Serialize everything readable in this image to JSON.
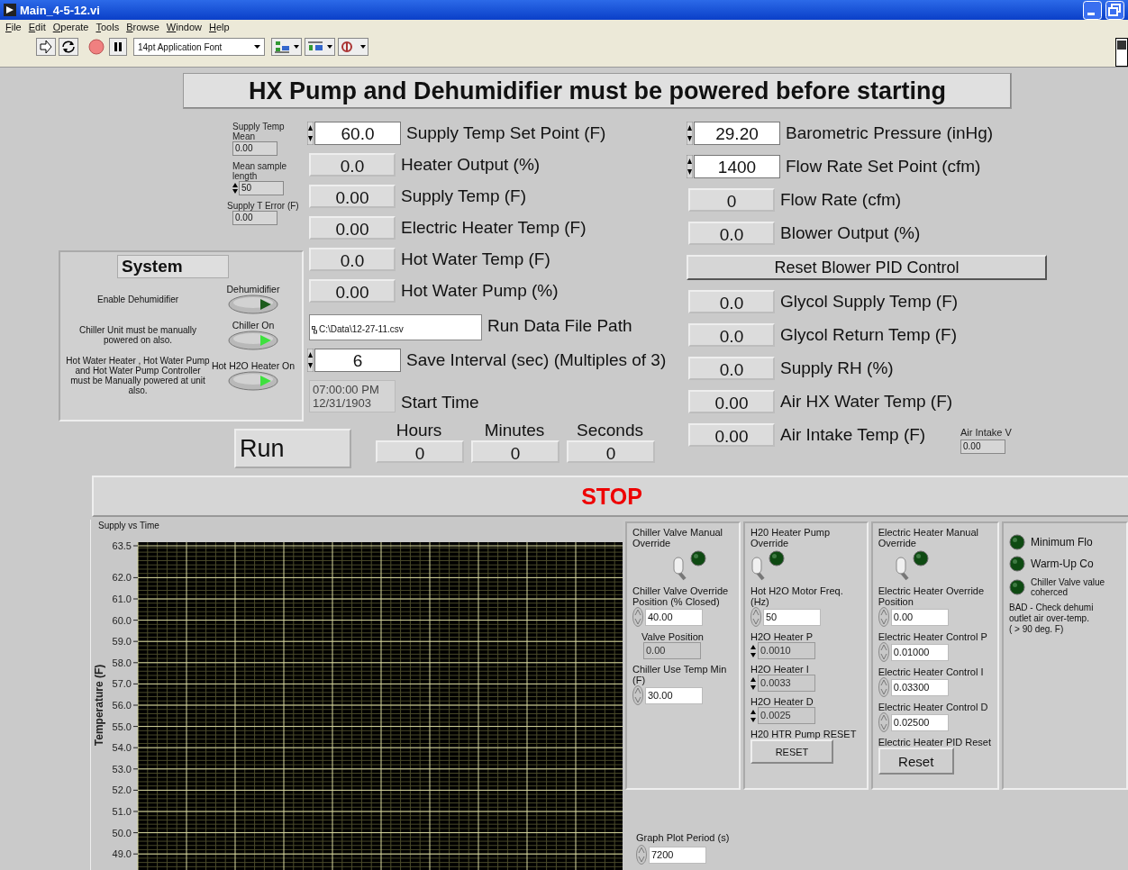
{
  "window": {
    "title": "Main_4-5-12.vi"
  },
  "menu": [
    "File",
    "Edit",
    "Operate",
    "Tools",
    "Browse",
    "Window",
    "Help"
  ],
  "toolbar": {
    "font": "14pt Application Font"
  },
  "banner": "HX Pump and Dehumidifier must be powered before starting",
  "small_indicators": [
    {
      "label": "Supply Temp Mean",
      "value": "0.00",
      "kind": "indicator"
    },
    {
      "label": "Mean sample length",
      "value": "50",
      "kind": "control"
    },
    {
      "label": "Supply T Error (F)",
      "value": "0.00",
      "kind": "indicator"
    }
  ],
  "left_fields": [
    {
      "kind": "control",
      "value": "60.0",
      "label": "Supply Temp Set Point (F)"
    },
    {
      "kind": "indicator",
      "value": "0.0",
      "label": "Heater Output (%)"
    },
    {
      "kind": "indicator",
      "value": "0.00",
      "label": "Supply Temp (F)"
    },
    {
      "kind": "indicator",
      "value": "0.00",
      "label": "Electric Heater Temp (F)"
    },
    {
      "kind": "indicator",
      "value": "0.0",
      "label": "Hot Water Temp (F)"
    },
    {
      "kind": "indicator",
      "value": "0.00",
      "label": "Hot Water Pump (%)"
    },
    {
      "kind": "path",
      "path": "C:\\Data\\12-27-11.csv",
      "label": "Run Data File Path"
    },
    {
      "kind": "control",
      "value": "6",
      "label": "Save Interval (sec) (Multiples of 3)"
    },
    {
      "kind": "timestamp",
      "lines": [
        "07:00:00 PM",
        "12/31/1903"
      ],
      "label": "Start Time"
    }
  ],
  "system": {
    "title": "System",
    "switches": [
      {
        "note": "Enable Dehumidifier",
        "label": "Dehumidifier",
        "on": false
      },
      {
        "note": "Chiller Unit must be manually powered on also.",
        "label": "Chiller On",
        "on": true
      },
      {
        "note": "Hot Water Heater , Hot Water Pump and Hot Water Pump Controller must be Manually powered at unit also.",
        "label": "Hot H2O Heater On",
        "on": true
      }
    ]
  },
  "run": "Run",
  "elapsed": [
    {
      "label": "Hours",
      "value": "0"
    },
    {
      "label": "Minutes",
      "value": "0"
    },
    {
      "label": "Seconds",
      "value": "0"
    }
  ],
  "right_fields": [
    {
      "kind": "control",
      "value": "29.20",
      "label": "Barometric Pressure (inHg)"
    },
    {
      "kind": "control",
      "value": "1400",
      "label": "Flow Rate Set Point (cfm)"
    },
    {
      "kind": "indicator",
      "value": "0",
      "label": "Flow Rate (cfm)"
    },
    {
      "kind": "indicator",
      "value": "0.0",
      "label": "Blower Output (%)"
    },
    {
      "kind": "button",
      "label": "Reset Blower PID Control"
    },
    {
      "kind": "indicator",
      "value": "0.0",
      "label": "Glycol Supply Temp (F)"
    },
    {
      "kind": "indicator",
      "value": "0.0",
      "label": "Glycol Return Temp (F)"
    },
    {
      "kind": "indicator",
      "value": "0.0",
      "label": "Supply RH (%)"
    },
    {
      "kind": "indicator",
      "value": "0.00",
      "label": "Air HX Water Temp (F)"
    },
    {
      "kind": "indicator",
      "value": "0.00",
      "label": "Air Intake Temp (F)"
    }
  ],
  "air_intake_v": {
    "label": "Air Intake V",
    "value": "0.00"
  },
  "stop": "STOP",
  "chart": {
    "title": "Supply vs Time",
    "y_axis_title": "Temperature (F)",
    "y_tick_labels": [
      "63.5",
      "62.0",
      "61.0",
      "60.0",
      "59.0",
      "58.0",
      "57.0",
      "56.0",
      "55.0",
      "54.0",
      "53.0",
      "52.0",
      "51.0",
      "50.0",
      "49.0"
    ]
  },
  "panels": [
    {
      "title": "Chiller Valve Manual Override",
      "switch_on": false,
      "led_on": false,
      "items": [
        {
          "kind": "control",
          "label": "Chiller Valve Override Position (% Closed)",
          "value": "40.00",
          "disabled": false
        },
        {
          "kind": "indicator",
          "label": "Valve Position",
          "value": "0.00"
        },
        {
          "kind": "control",
          "label": "Chiller Use Temp Min (F)",
          "value": "30.00",
          "disabled": false
        }
      ]
    },
    {
      "title": "H20 Heater Pump Override",
      "switch_on": false,
      "led_on": false,
      "items": [
        {
          "kind": "control",
          "label": "Hot H2O Motor Freq. (Hz)",
          "value": "50",
          "disabled": false
        },
        {
          "kind": "control",
          "label": "H2O Heater P",
          "value": "0.0010",
          "disabled": true
        },
        {
          "kind": "control",
          "label": "H2O Heater I",
          "value": "0.0033",
          "disabled": true
        },
        {
          "kind": "control",
          "label": "H2O Heater D",
          "value": "0.0025",
          "disabled": true
        },
        {
          "kind": "button",
          "label": "H20 HTR Pump RESET",
          "text": "RESET"
        }
      ]
    },
    {
      "title": "Electric Heater Manual Override",
      "switch_on": false,
      "led_on": false,
      "items": [
        {
          "kind": "control",
          "label": "Electric Heater Override Position",
          "value": "0.00",
          "disabled": false
        },
        {
          "kind": "control",
          "label": "Electric Heater Control P",
          "value": "0.01000",
          "disabled": false
        },
        {
          "kind": "control",
          "label": "Electric Heater Control I",
          "value": "0.03300",
          "disabled": false
        },
        {
          "kind": "control",
          "label": "Electric Heater Control D",
          "value": "0.02500",
          "disabled": false
        },
        {
          "kind": "button",
          "label": "Electric Heater PID Reset",
          "text": "Reset"
        }
      ]
    }
  ],
  "status_leds": [
    {
      "label": "Minimum Flo",
      "on": false
    },
    {
      "label": "Warm-Up Co",
      "on": false
    },
    {
      "label": "Chiller Valve value coherced",
      "on": false
    }
  ],
  "status_message": [
    "BAD - Check dehumi",
    "outlet air over-temp.",
    "( > 90 deg. F)"
  ],
  "graph_plot_period": {
    "label": "Graph Plot Period (s)",
    "value": "7200"
  }
}
